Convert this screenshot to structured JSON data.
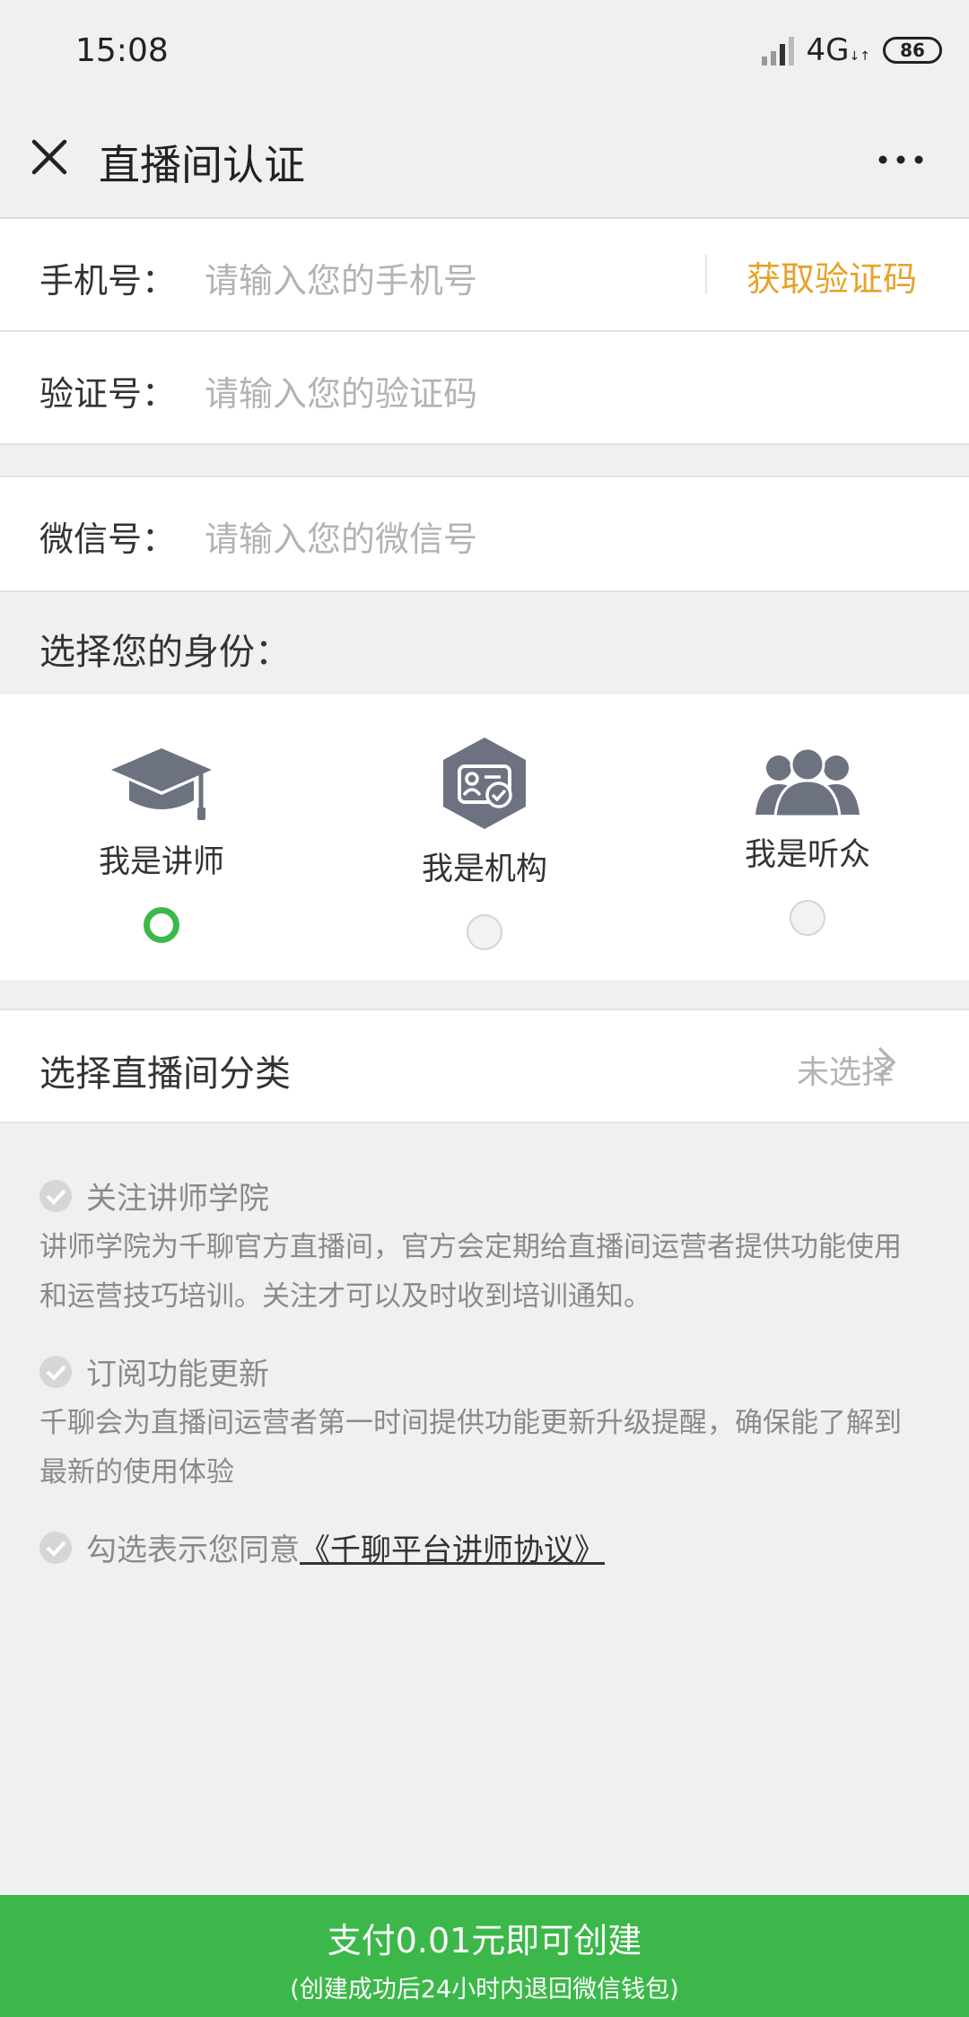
{
  "status": {
    "time": "15:08",
    "network": "4G",
    "battery": "86"
  },
  "nav": {
    "title": "直播间认证",
    "close_icon": "close-icon",
    "more_icon": "more-icon"
  },
  "form": {
    "phone": {
      "label": "手机号：",
      "placeholder": "请输入您的手机号",
      "action": "获取验证码"
    },
    "code": {
      "label": "验证号：",
      "placeholder": "请输入您的验证码"
    },
    "wechat": {
      "label": "微信号：",
      "placeholder": "请输入您的微信号"
    }
  },
  "identity": {
    "title": "选择您的身份：",
    "options": [
      {
        "label": "我是讲师",
        "icon": "graduation-cap-icon",
        "selected": true
      },
      {
        "label": "我是机构",
        "icon": "id-card-icon",
        "selected": false
      },
      {
        "label": "我是听众",
        "icon": "audience-icon",
        "selected": false
      }
    ]
  },
  "category": {
    "title": "选择直播间分类",
    "value": "未选择"
  },
  "options": {
    "follow": {
      "title": "关注讲师学院",
      "desc": "讲师学院为千聊官方直播间，官方会定期给直播间运营者提供功能使用和运营技巧培训。关注才可以及时收到培训通知。"
    },
    "subscribe": {
      "title": "订阅功能更新",
      "desc": "千聊会为直播间运营者第一时间提供功能更新升级提醒，确保能了解到最新的使用体验"
    },
    "agreement": {
      "prefix": "勾选表示您同意",
      "link": "《千聊平台讲师协议》"
    }
  },
  "pay": {
    "main": "支付0.01元即可创建",
    "sub": "(创建成功后24小时内退回微信钱包)"
  },
  "colors": {
    "accent": "#3cb84a",
    "link_orange": "#e4a32b",
    "icon_gray": "#6d7281"
  }
}
